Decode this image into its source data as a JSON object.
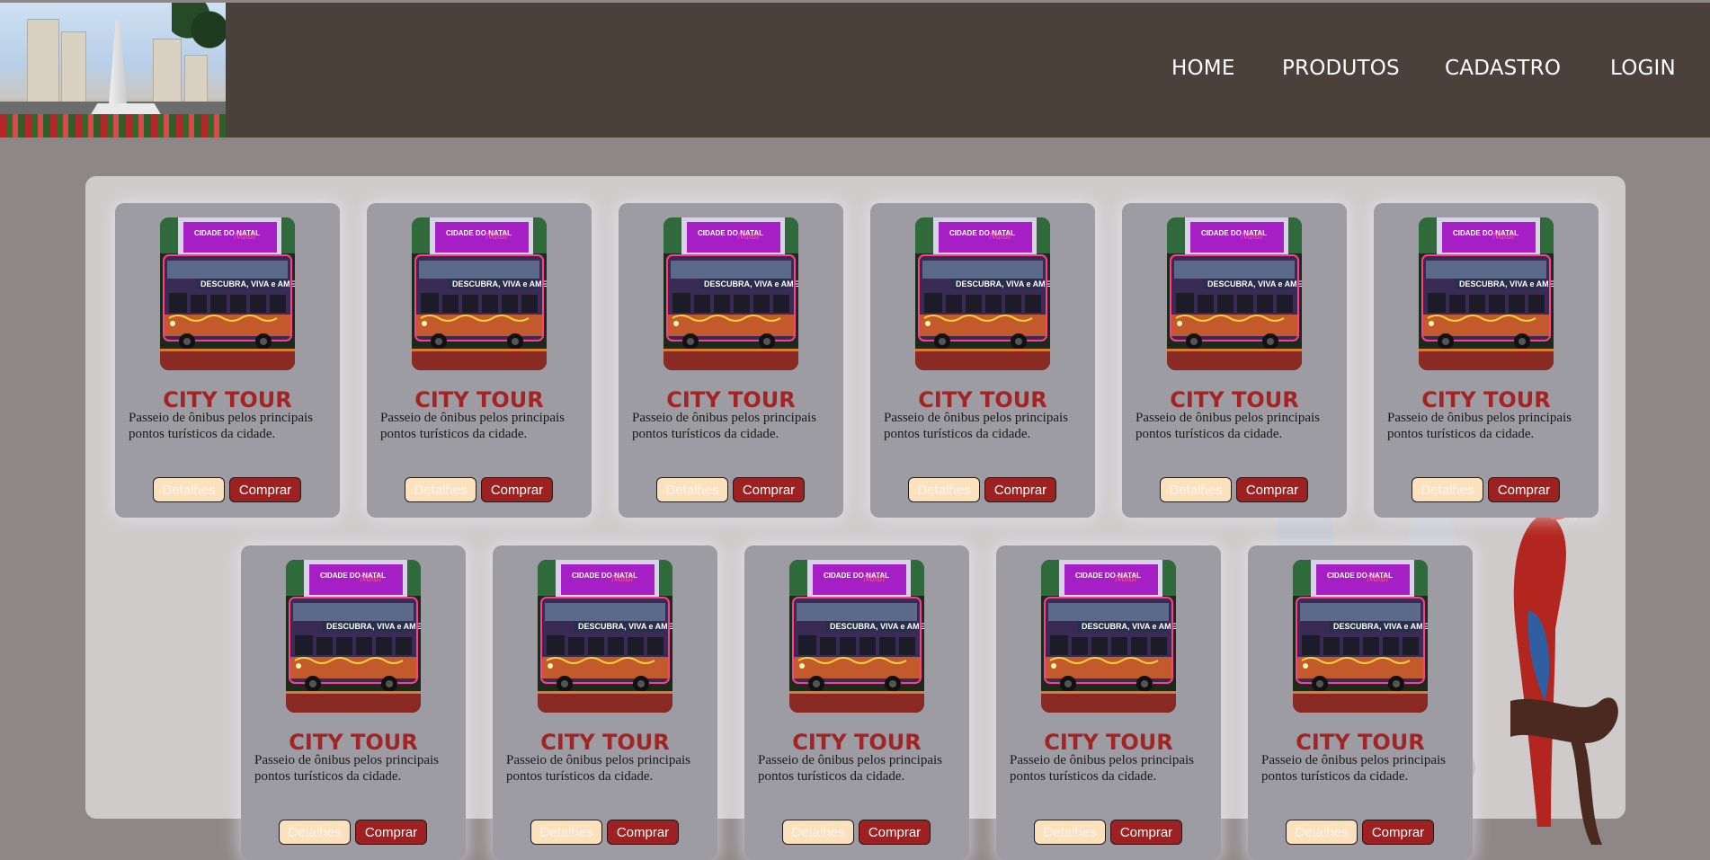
{
  "header": {
    "logo_alt": "city skyline logo",
    "nav": [
      {
        "label": "HOME"
      },
      {
        "label": "PRODUTOS"
      },
      {
        "label": "CADASTRO"
      },
      {
        "label": "LOGIN"
      }
    ]
  },
  "products": [
    {
      "title": "CITY TOUR",
      "description": "Passeio de ônibus pelos principais pontos turísticos da cidade.",
      "details_label": "Detalhes",
      "buy_label": "Comprar"
    },
    {
      "title": "CITY TOUR",
      "description": "Passeio de ônibus pelos principais pontos turísticos da cidade.",
      "details_label": "Detalhes",
      "buy_label": "Comprar"
    },
    {
      "title": "CITY TOUR",
      "description": "Passeio de ônibus pelos principais pontos turísticos da cidade.",
      "details_label": "Detalhes",
      "buy_label": "Comprar"
    },
    {
      "title": "CITY TOUR",
      "description": "Passeio de ônibus pelos principais pontos turísticos da cidade.",
      "details_label": "Detalhes",
      "buy_label": "Comprar"
    },
    {
      "title": "CITY TOUR",
      "description": "Passeio de ônibus pelos principais pontos turísticos da cidade.",
      "details_label": "Detalhes",
      "buy_label": "Comprar"
    },
    {
      "title": "CITY TOUR",
      "description": "Passeio de ônibus pelos principais pontos turísticos da cidade.",
      "details_label": "Detalhes",
      "buy_label": "Comprar"
    },
    {
      "title": "CITY TOUR",
      "description": "Passeio de ônibus pelos principais pontos turísticos da cidade.",
      "details_label": "Detalhes",
      "buy_label": "Comprar"
    },
    {
      "title": "CITY TOUR",
      "description": "Passeio de ônibus pelos principais pontos turísticos da cidade.",
      "details_label": "Detalhes",
      "buy_label": "Comprar"
    },
    {
      "title": "CITY TOUR",
      "description": "Passeio de ônibus pelos principais pontos turísticos da cidade.",
      "details_label": "Detalhes",
      "buy_label": "Comprar"
    },
    {
      "title": "CITY TOUR",
      "description": "Passeio de ônibus pelos principais pontos turísticos da cidade.",
      "details_label": "Detalhes",
      "buy_label": "Comprar"
    },
    {
      "title": "CITY TOUR",
      "description": "Passeio de ônibus pelos principais pontos turísticos da cidade.",
      "details_label": "Detalhes",
      "buy_label": "Comprar"
    }
  ],
  "bus_sign": {
    "top": "CIDADE DO NATAL",
    "script": "Natal",
    "banner": "DESCUBRA, VIVA e AME"
  },
  "colors": {
    "header_bg": "#4b413a",
    "page_bg": "#8e8787",
    "panel_bg": "#cfcbcb",
    "card_bg": "#9d9ca2",
    "title": "#a22424",
    "buy_btn": "#9e2122",
    "details_btn": "#fbe2bd"
  }
}
